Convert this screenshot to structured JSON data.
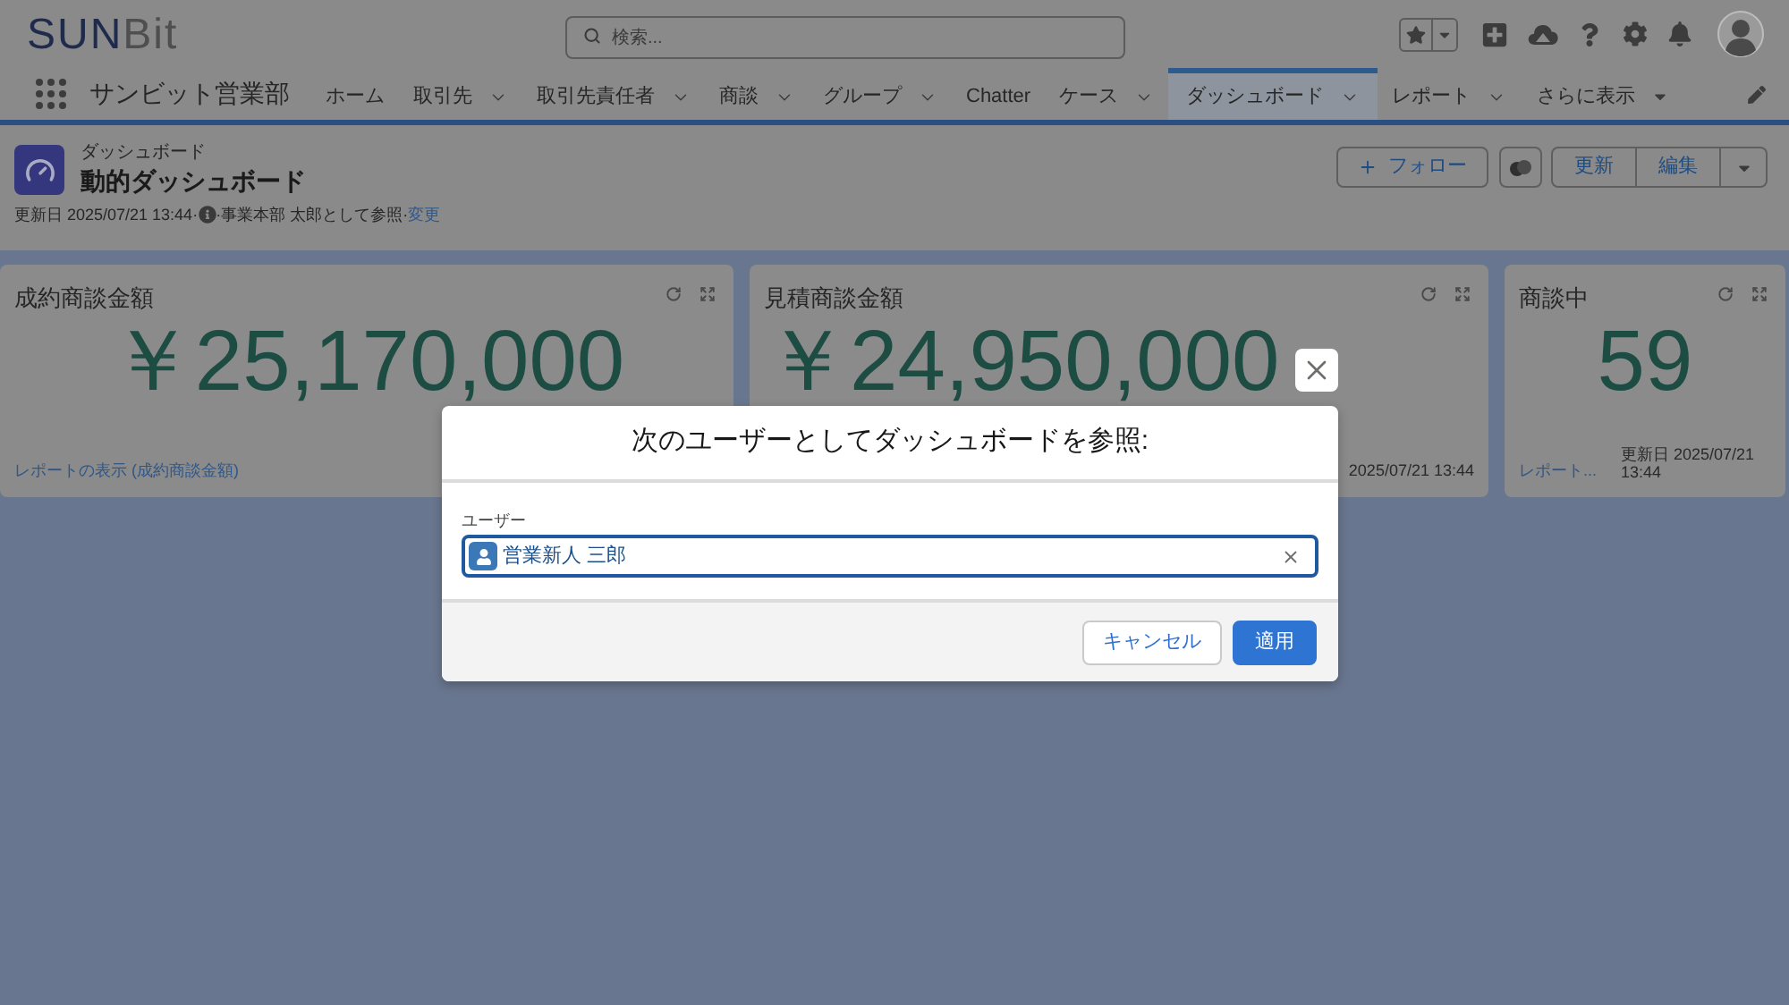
{
  "header": {
    "logo": {
      "part_1": "SUN",
      "part_2": "Bit"
    },
    "search": {
      "placeholder": "検索..."
    }
  },
  "nav": {
    "app_name": "サンビット営業部",
    "tabs": [
      {
        "label": "ホーム",
        "selected": false,
        "has_menu": false
      },
      {
        "label": "取引先",
        "selected": false,
        "has_menu": true
      },
      {
        "label": "取引先責任者",
        "selected": false,
        "has_menu": true
      },
      {
        "label": "商談",
        "selected": false,
        "has_menu": true
      },
      {
        "label": "グループ",
        "selected": false,
        "has_menu": true
      },
      {
        "label": "Chatter",
        "selected": false,
        "has_menu": false
      },
      {
        "label": "ケース",
        "selected": false,
        "has_menu": true
      },
      {
        "label": "ダッシュボード",
        "selected": true,
        "has_menu": true
      },
      {
        "label": "レポート",
        "selected": false,
        "has_menu": true
      }
    ],
    "more": "さらに表示"
  },
  "dashboard": {
    "type_label": "ダッシュボード",
    "title": "動的ダッシュボード",
    "updated": "更新日 2025/07/21 13:44·",
    "viewing_as": "·事業本部 太郎として参照·",
    "change_link": "変更",
    "buttons": {
      "follow": "フォロー",
      "refresh": "更新",
      "edit": "編集"
    }
  },
  "cards": [
    {
      "title": "成約商談金額",
      "value": "￥25,170,000",
      "report_link": "レポートの表示 (成約商談金額)"
    },
    {
      "title": "見積商談金額",
      "value": "￥24,950,000",
      "updated": "2025/07/21 13:44"
    },
    {
      "title": "商談中",
      "value": "59",
      "report_link": "レポート...",
      "updated": "更新日 2025/07/21 13:44"
    }
  ],
  "modal": {
    "title": "次のユーザーとしてダッシュボードを参照:",
    "field_label": "ユーザー",
    "user_value": "営業新人 三郎",
    "buttons": {
      "cancel": "キャンセル",
      "apply": "適用"
    }
  }
}
